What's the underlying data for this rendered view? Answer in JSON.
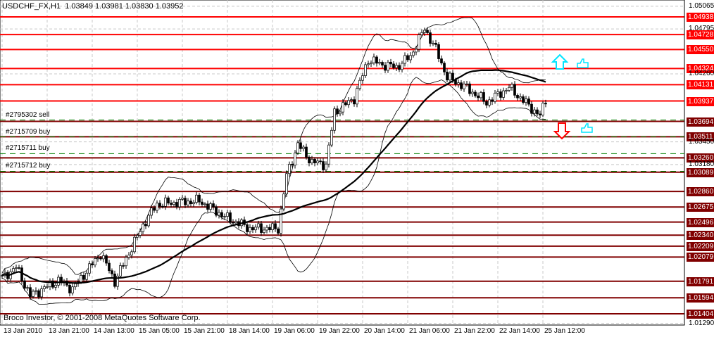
{
  "header": {
    "title": "USDCHF_FX,H1  1.03849 1.03981 1.03830 1.03952"
  },
  "footer": {
    "copyright": "Broco Investor, © 2001-2008 MetaQuotes Software Corp."
  },
  "colors": {
    "resistance": "#ff0000",
    "support": "#800000",
    "order": "#008000",
    "candle": "#000000",
    "arrow_up": "#00e5ff",
    "arrow_down": "#ff0000"
  },
  "orders": [
    {
      "label": "#2795302 sell",
      "price": 1.0371
    },
    {
      "label": "#2715709 buy",
      "price": 1.0351
    },
    {
      "label": "#2715711 buy",
      "price": 1.0331
    },
    {
      "label": "#2715712 buy",
      "price": 1.031
    }
  ],
  "chart_data": {
    "type": "candlestick",
    "symbol": "USDCHF_FX",
    "timeframe": "H1",
    "ylim": [
      1.0126,
      1.051
    ],
    "y_ticks": [
      "1.05065",
      "1.04795",
      "1.04260",
      "1.03450",
      "1.03180",
      "1.01290"
    ],
    "x_labels": [
      "13 Jan 2010",
      "13 Jan 21:00",
      "14 Jan 13:00",
      "15 Jan 05:00",
      "15 Jan 21:00",
      "18 Jan 14:00",
      "19 Jan 06:00",
      "19 Jan 22:00",
      "20 Jan 14:00",
      "21 Jan 06:00",
      "21 Jan 22:00",
      "22 Jan 14:00",
      "25 Jan 12:00"
    ],
    "bars_per_label": 16,
    "levels_resistance": [
      "1.04938",
      "1.04728",
      "1.04550",
      "1.04324",
      "1.04131",
      "1.03937"
    ],
    "levels_support": [
      "1.03694",
      "1.03511",
      "1.03260",
      "1.03089",
      "1.02860",
      "1.02675",
      "1.02496",
      "1.02340",
      "1.02209",
      "1.02079",
      "1.01791",
      "1.01594",
      "1.01404"
    ],
    "close_path": [
      [
        0,
        1.0183
      ],
      [
        5,
        1.0196
      ],
      [
        10,
        1.0162
      ],
      [
        20,
        1.018
      ],
      [
        25,
        1.017
      ],
      [
        35,
        1.0212
      ],
      [
        40,
        1.0179
      ],
      [
        50,
        1.0246
      ],
      [
        55,
        1.0271
      ],
      [
        70,
        1.0275
      ],
      [
        80,
        1.0254
      ],
      [
        88,
        1.0242
      ],
      [
        98,
        1.0242
      ],
      [
        101,
        1.0305
      ],
      [
        105,
        1.0342
      ],
      [
        110,
        1.0321
      ],
      [
        115,
        1.0318
      ],
      [
        118,
        1.038
      ],
      [
        125,
        1.0397
      ],
      [
        130,
        1.0443
      ],
      [
        135,
        1.0437
      ],
      [
        140,
        1.0434
      ],
      [
        145,
        1.0447
      ],
      [
        150,
        1.048
      ],
      [
        154,
        1.0455
      ],
      [
        158,
        1.0422
      ],
      [
        165,
        1.0409
      ],
      [
        172,
        1.0392
      ],
      [
        180,
        1.041
      ],
      [
        187,
        1.0388
      ],
      [
        191,
        1.0376
      ],
      [
        193,
        1.0395
      ]
    ],
    "ma_period": 50,
    "bands_period": 20,
    "bands_dev": 2
  },
  "signals": {
    "up": "arrow-up",
    "down": "arrow-down",
    "thumb": "thumbs-up"
  }
}
